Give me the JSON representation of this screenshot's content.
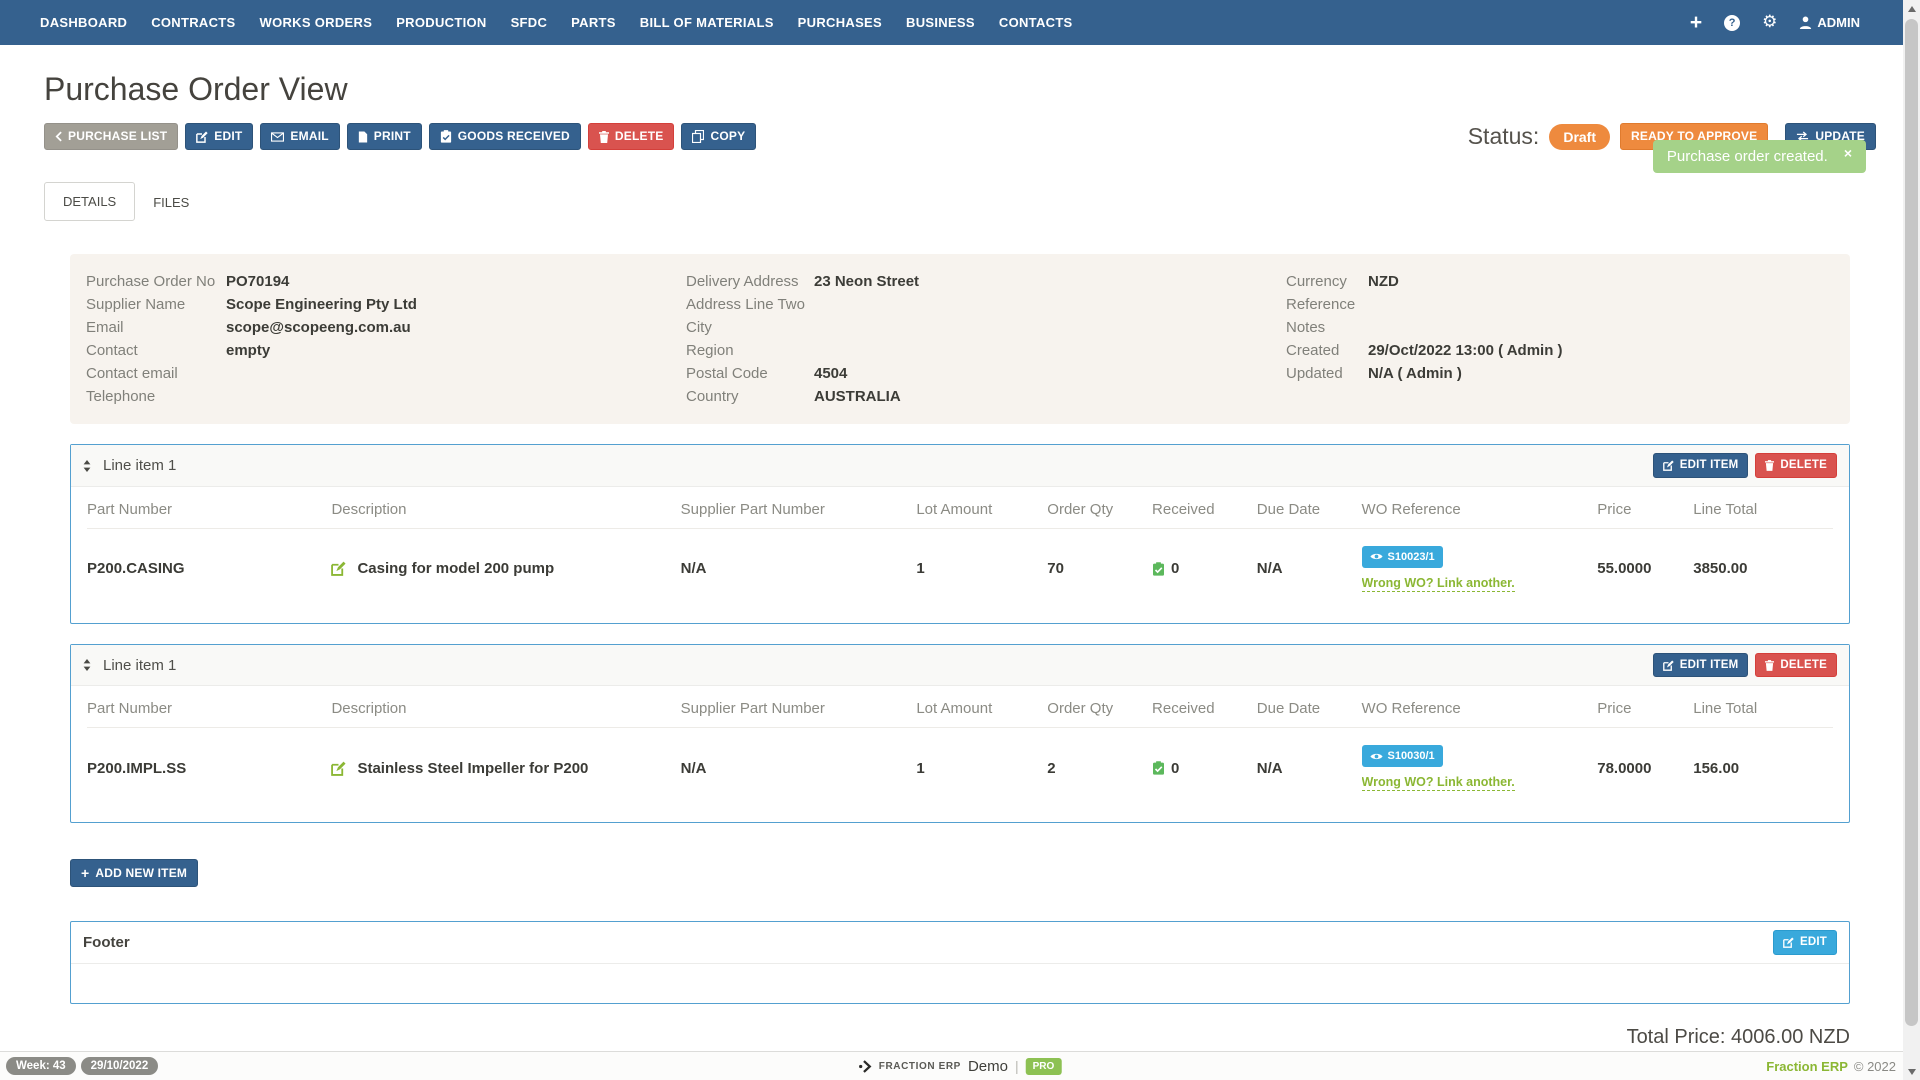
{
  "colors": {
    "brand_blue": "#35618e",
    "danger_red": "#d9534f",
    "orange": "#ee8a3e",
    "cyan": "#39a9dc",
    "toast_green": "#a5d289",
    "lime_green": "#8bb734",
    "pro_green": "#8dc153",
    "panel_beige": "#f7f3ee",
    "card_border_blue": "#54a0d0",
    "received_green": "#5cb85c"
  },
  "icons": {
    "plus-icon": "+",
    "help-icon": "?",
    "gear-icon": "⚙",
    "user-icon": "person-silhouette",
    "chevron-left-icon": "‹",
    "edit-icon": "pencil-square",
    "email-icon": "envelope",
    "print-icon": "document",
    "goods-received-icon": "clipboard-check",
    "delete-icon": "trash-can",
    "copy-icon": "overlapping-pages",
    "update-icon": "swap-arrows",
    "sort-icon": "up-down-arrows",
    "received-icon": "green-clipboard-check",
    "eye-icon": "eye",
    "close-icon": "×",
    "logo-icon": "dot-chevron"
  },
  "nav": {
    "items": [
      "DASHBOARD",
      "CONTRACTS",
      "WORKS ORDERS",
      "PRODUCTION",
      "SFDC",
      "PARTS",
      "BILL OF MATERIALS",
      "PURCHASES",
      "BUSINESS",
      "CONTACTS"
    ],
    "admin_label": "ADMIN"
  },
  "toast": {
    "message": "Purchase order created.",
    "close": "×"
  },
  "page_title": "Purchase Order View",
  "toolbar": {
    "purchase_list": "PURCHASE LIST",
    "edit": "EDIT",
    "email": "EMAIL",
    "print": "PRINT",
    "goods_received": "GOODS RECEIVED",
    "delete": "DELETE",
    "copy": "COPY"
  },
  "status": {
    "label": "Status:",
    "badge": "Draft",
    "ready_to_approve": "READY TO APPROVE",
    "update": "UPDATE"
  },
  "tabs": {
    "details": "DETAILS",
    "files": "FILES"
  },
  "details": {
    "col1": [
      {
        "label": "Purchase Order No",
        "value": "PO70194"
      },
      {
        "label": "Supplier Name",
        "value": "Scope Engineering Pty Ltd"
      },
      {
        "label": "Email",
        "value": "scope@scopeeng.com.au"
      },
      {
        "label": "Contact",
        "value": "empty"
      },
      {
        "label": "Contact email",
        "value": ""
      },
      {
        "label": "Telephone",
        "value": ""
      }
    ],
    "col2": [
      {
        "label": "Delivery Address",
        "value": "23 Neon Street"
      },
      {
        "label": "Address Line Two",
        "value": ""
      },
      {
        "label": "City",
        "value": ""
      },
      {
        "label": "Region",
        "value": ""
      },
      {
        "label": "Postal Code",
        "value": "4504"
      },
      {
        "label": "Country",
        "value": "AUSTRALIA"
      }
    ],
    "col3": [
      {
        "label": "Currency",
        "value": "NZD"
      },
      {
        "label": "Reference",
        "value": ""
      },
      {
        "label": "Notes",
        "value": ""
      },
      {
        "label": "Created",
        "value": "29/Oct/2022 13:00 ( Admin )"
      },
      {
        "label": "Updated",
        "value": "N/A ( Admin )"
      }
    ]
  },
  "line_items_columns": [
    "Part Number",
    "Description",
    "Supplier Part Number",
    "Lot Amount",
    "Order Qty",
    "Received",
    "Due Date",
    "WO Reference",
    "Price",
    "Line Total"
  ],
  "item_actions": {
    "edit_item": "EDIT ITEM",
    "delete": "DELETE"
  },
  "wo_link_text": "Wrong WO? Link another.",
  "line_items": [
    {
      "title": "Line item 1",
      "part_number": "P200.CASING",
      "description": "Casing for model 200 pump",
      "supplier_part_number": "N/A",
      "lot_amount": "1",
      "order_qty": "70",
      "received": "0",
      "due_date": "N/A",
      "wo_reference": "S10023/1",
      "price": "55.0000",
      "line_total": "3850.00"
    },
    {
      "title": "Line item 1",
      "part_number": "P200.IMPL.SS",
      "description": "Stainless Steel Impeller for P200",
      "supplier_part_number": "N/A",
      "lot_amount": "1",
      "order_qty": "2",
      "received": "0",
      "due_date": "N/A",
      "wo_reference": "S10030/1",
      "price": "78.0000",
      "line_total": "156.00"
    }
  ],
  "add_new_item_label": "ADD NEW ITEM",
  "footer_section": {
    "title": "Footer",
    "edit": "EDIT"
  },
  "total_price": "Total Price: 4006.00 NZD",
  "status_bar": {
    "week": "Week: 43",
    "date": "29/10/2022",
    "brand_small": "FRACTION ERP",
    "brand_demo": "Demo",
    "separator": "|",
    "pro": "PRO",
    "brand_name": "Fraction ERP",
    "copyright": "© 2022"
  }
}
